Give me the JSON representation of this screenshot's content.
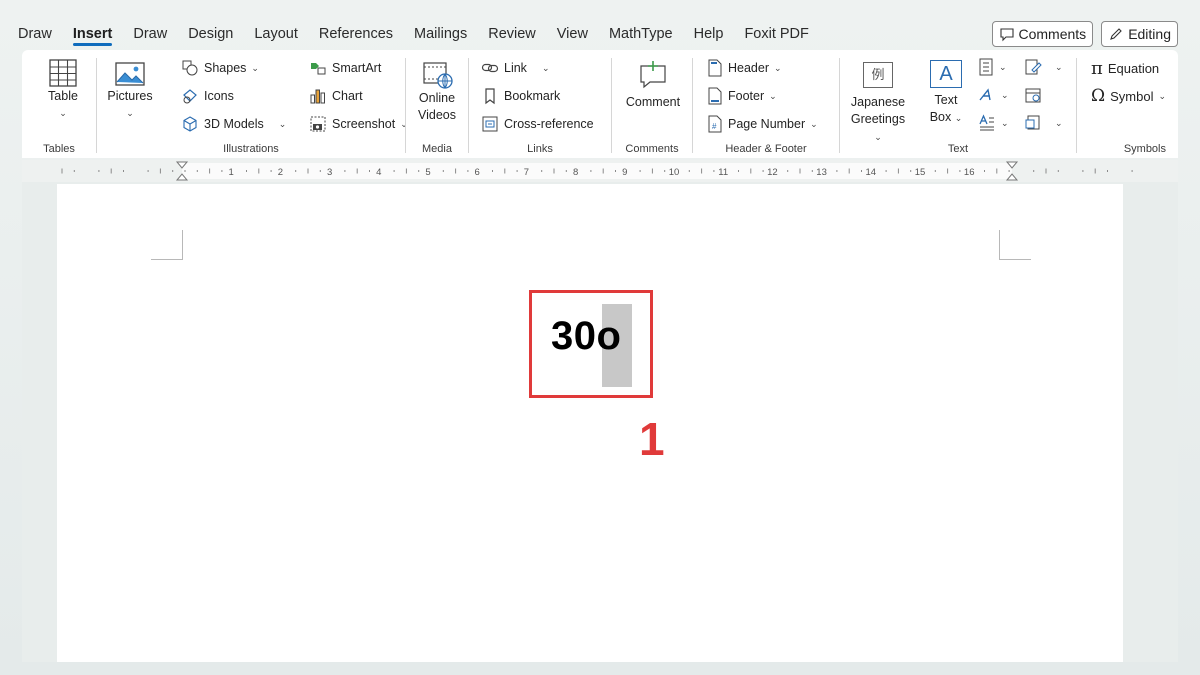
{
  "menu": {
    "tabs": [
      "Draw",
      "Insert",
      "Draw",
      "Design",
      "Layout",
      "References",
      "Mailings",
      "Review",
      "View",
      "MathType",
      "Help",
      "Foxit PDF"
    ],
    "active_index": 1,
    "comments_label": "Comments",
    "editing_label": "Editing"
  },
  "ribbon": {
    "tables": {
      "group": "Tables",
      "table": "Table"
    },
    "illustrations": {
      "group": "Illustrations",
      "pictures": "Pictures",
      "shapes": "Shapes",
      "icons": "Icons",
      "models": "3D Models",
      "smartart": "SmartArt",
      "chart": "Chart",
      "screenshot": "Screenshot"
    },
    "media": {
      "group": "Media",
      "online_line1": "Online",
      "online_line2": "Videos"
    },
    "links": {
      "group": "Links",
      "link": "Link",
      "bookmark": "Bookmark",
      "crossref": "Cross-reference"
    },
    "comments": {
      "group": "Comments",
      "comment": "Comment"
    },
    "header_footer": {
      "group": "Header & Footer",
      "header": "Header",
      "footer": "Footer",
      "page_number": "Page Number"
    },
    "text": {
      "group": "Text",
      "japanese_line1": "Japanese",
      "japanese_line2": "Greetings",
      "textbox_line1": "Text",
      "textbox_line2": "Box",
      "japanese_glyph": "例",
      "textbox_glyph": "A"
    },
    "symbols": {
      "group": "Symbols",
      "equation": "Equation",
      "symbol": "Symbol"
    }
  },
  "ruler": {
    "numbers": [
      "1",
      "2",
      "3",
      "4",
      "5",
      "6",
      "7",
      "8",
      "9",
      "10",
      "11",
      "12",
      "13",
      "14",
      "15",
      "16"
    ]
  },
  "document": {
    "text": "30o",
    "step_number": "1"
  },
  "colors": {
    "accent": "#0f6cbd",
    "annotation": "#e03a3a",
    "selection": "#c8c8c8"
  }
}
